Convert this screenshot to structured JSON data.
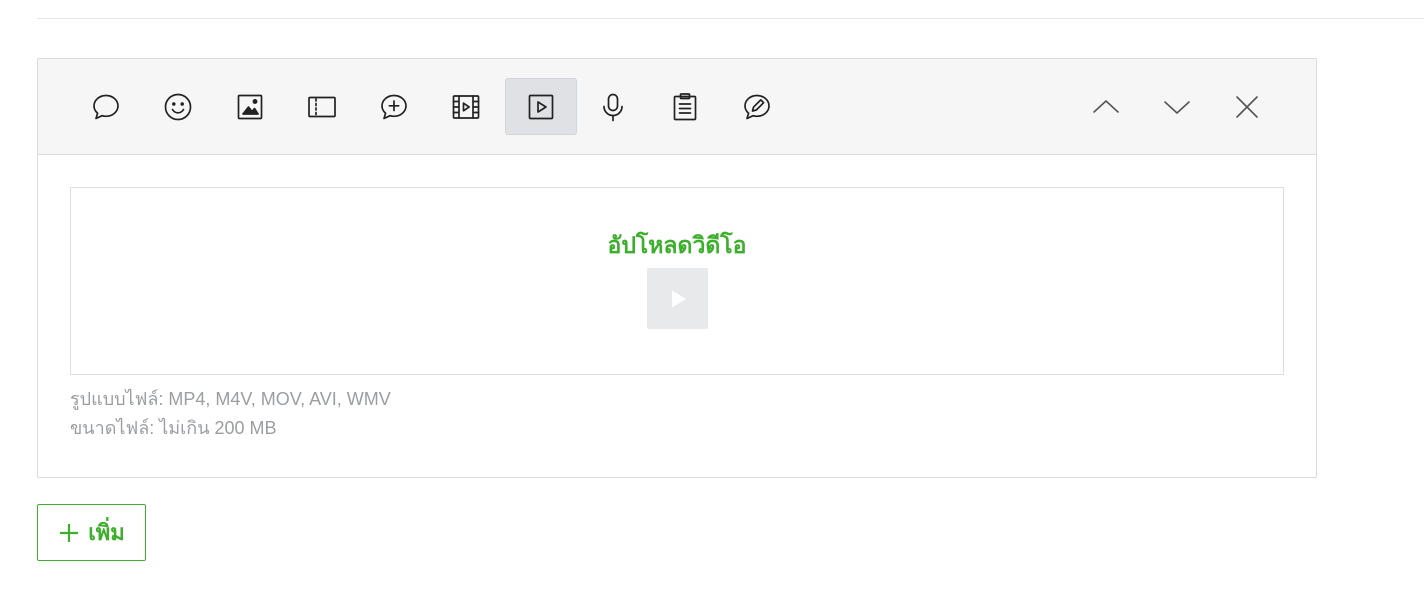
{
  "toolbar": {
    "tools": [
      {
        "name": "text-message",
        "icon": "speech-bubble-icon"
      },
      {
        "name": "sticker",
        "icon": "smiley-icon"
      },
      {
        "name": "image",
        "icon": "image-icon"
      },
      {
        "name": "card",
        "icon": "ticket-icon"
      },
      {
        "name": "rich-message",
        "icon": "chat-plus-icon"
      },
      {
        "name": "rich-video",
        "icon": "film-icon"
      },
      {
        "name": "video",
        "icon": "play-box-icon",
        "active": true
      },
      {
        "name": "audio",
        "icon": "microphone-icon"
      },
      {
        "name": "survey",
        "icon": "clipboard-icon"
      },
      {
        "name": "coupon",
        "icon": "edit-circle-icon"
      }
    ],
    "nav": [
      "chevron-up-icon",
      "chevron-down-icon",
      "close-icon"
    ]
  },
  "upload": {
    "title": "อัปโหลดวิดีโอ",
    "formats": "รูปแบบไฟล์: MP4, M4V, MOV, AVI, WMV",
    "size_limit": "ขนาดไฟล์: ไม่เกิน 200 MB"
  },
  "add_button": {
    "label": "เพิ่ม"
  },
  "colors": {
    "accent": "#3eaf2d",
    "hint_text": "#9a9ea3",
    "toolbar_bg": "#f6f6f6",
    "active_tool_bg": "#dfe1e4"
  }
}
